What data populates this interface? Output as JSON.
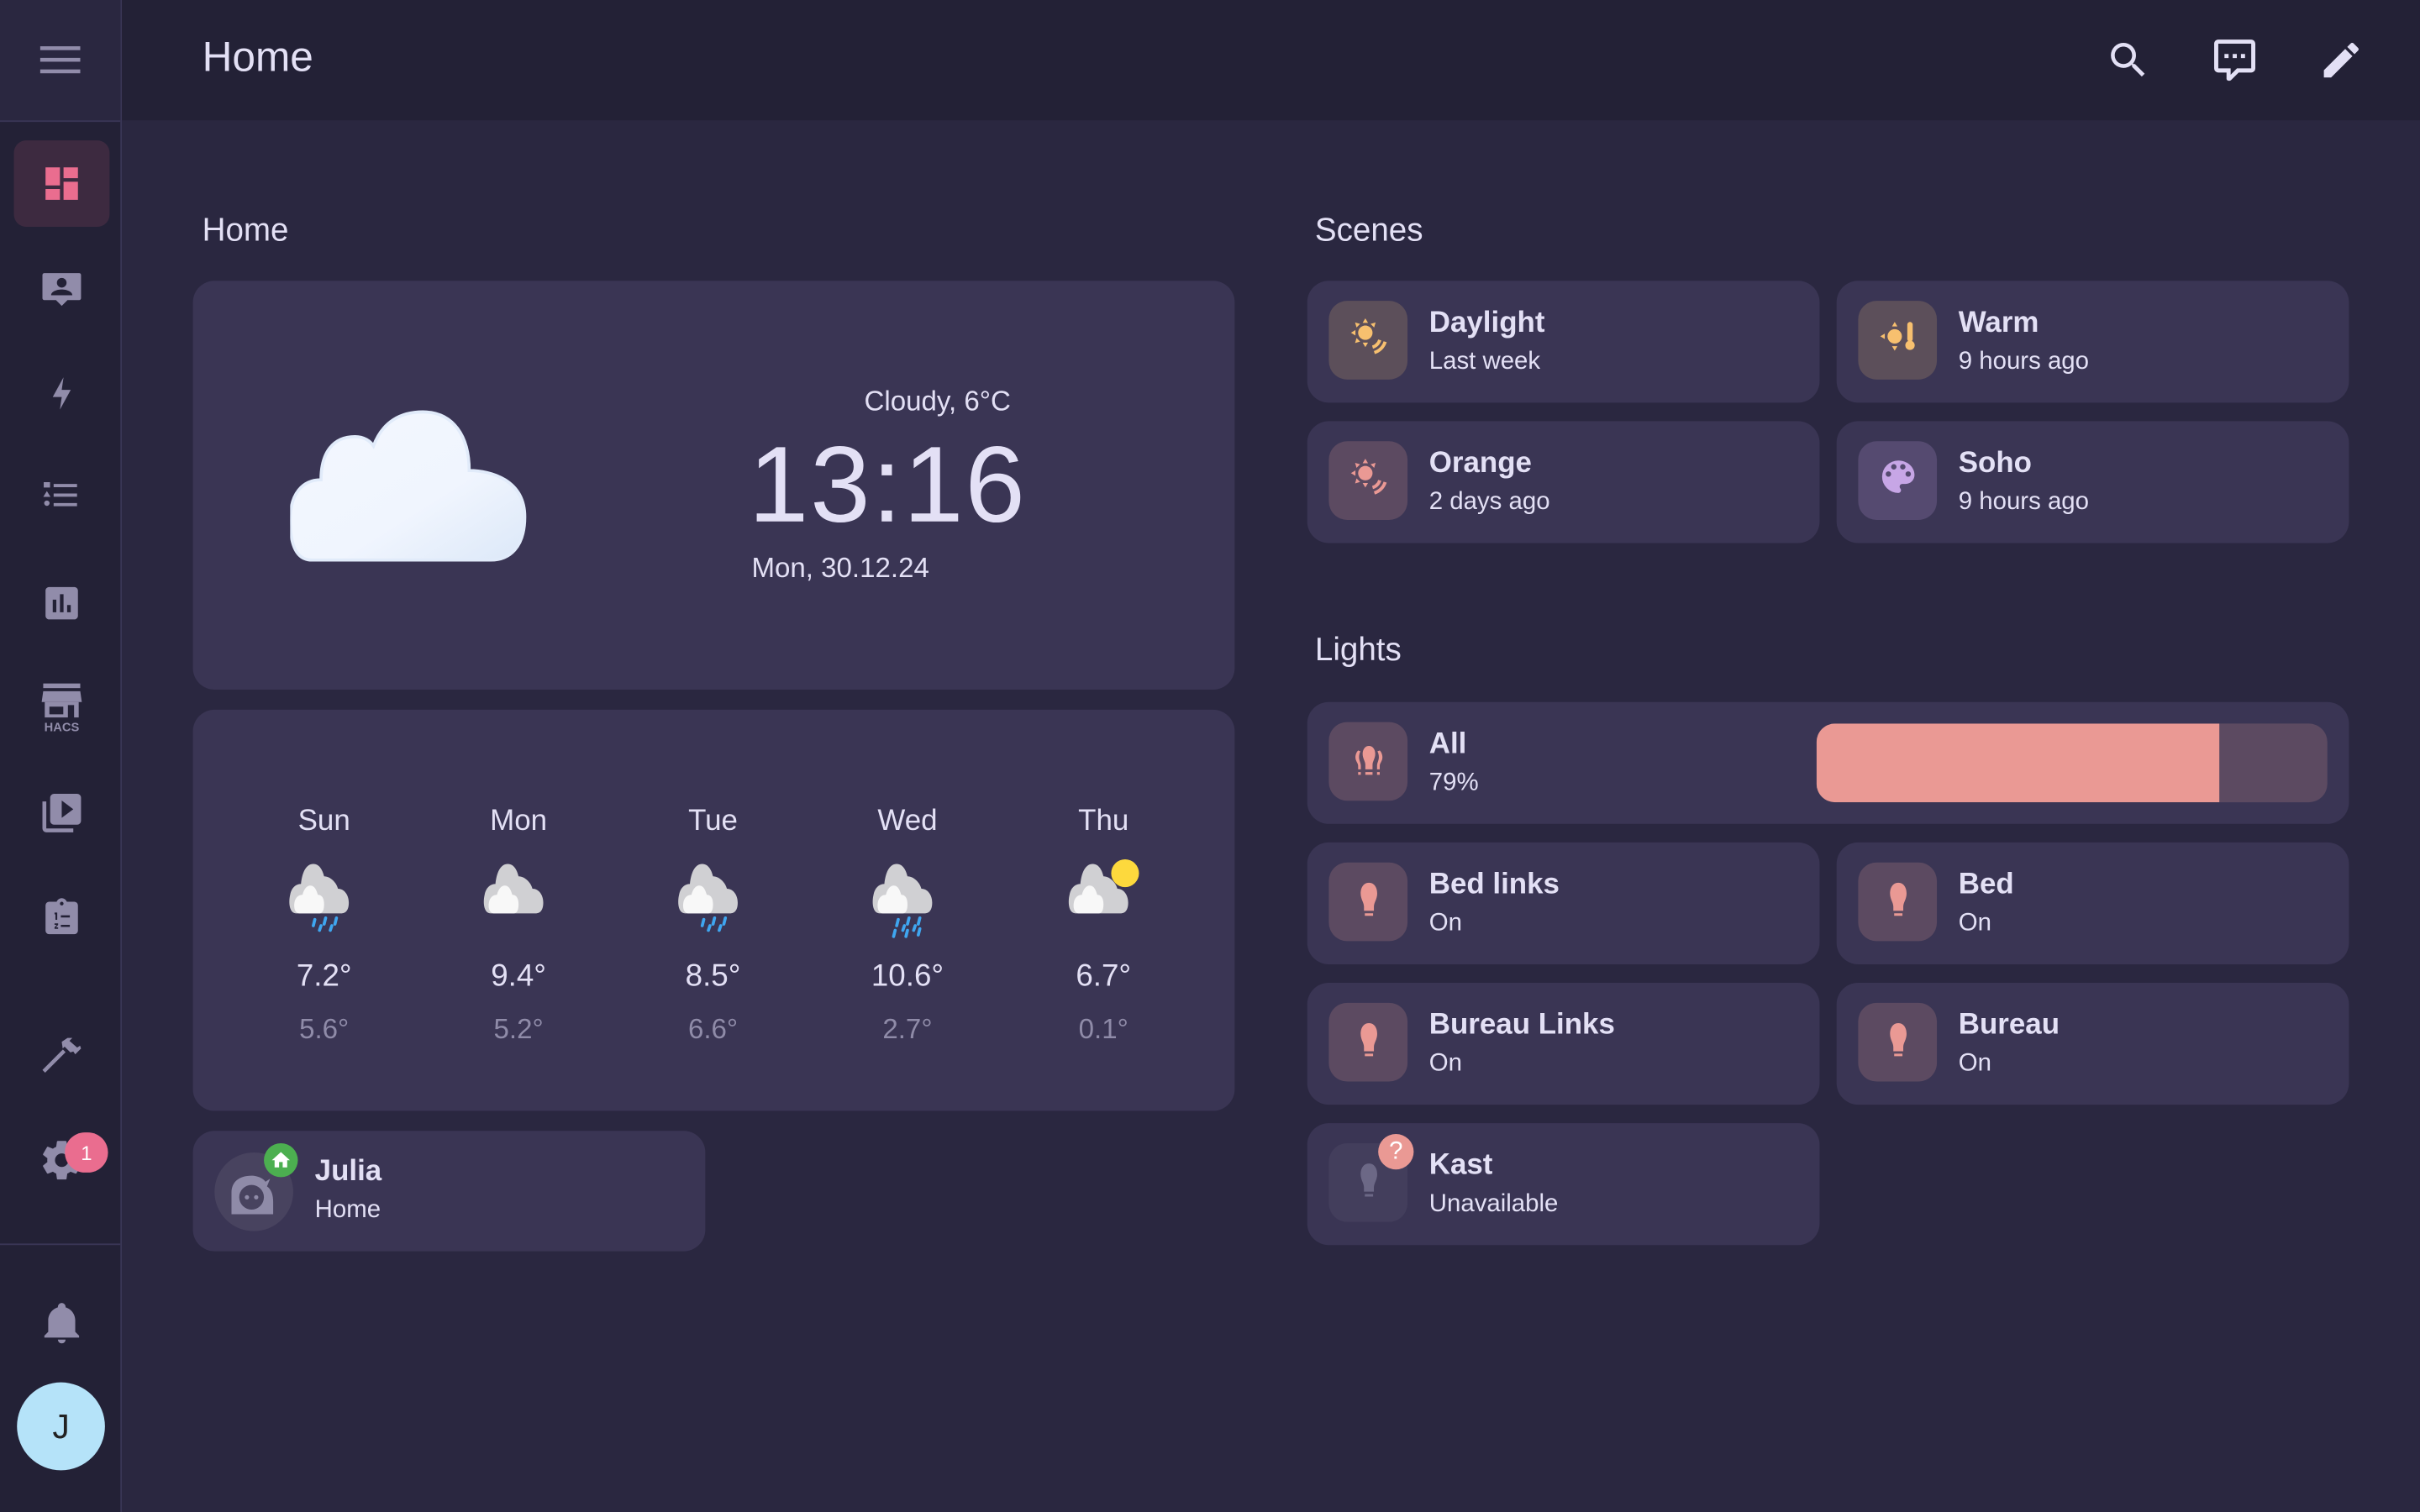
{
  "topbar": {
    "title": "Home",
    "icons": [
      "search-icon",
      "assist-chat-icon",
      "edit-pencil-icon"
    ]
  },
  "sidebar": {
    "items": [
      {
        "name": "overview",
        "icon": "dashboard-icon",
        "active": true
      },
      {
        "name": "map",
        "icon": "account-box-icon"
      },
      {
        "name": "energy",
        "icon": "lightning-icon"
      },
      {
        "name": "logbook",
        "icon": "format-list-icon"
      },
      {
        "name": "history",
        "icon": "chart-box-icon"
      },
      {
        "name": "hacs",
        "icon": "hacs-store-icon",
        "label": "HACS"
      },
      {
        "name": "media",
        "icon": "play-box-multiple-icon"
      },
      {
        "name": "todo",
        "icon": "clipboard-list-icon"
      },
      {
        "name": "developer-tools",
        "icon": "hammer-icon"
      },
      {
        "name": "settings",
        "icon": "cog-icon",
        "badge": "1"
      }
    ],
    "notifications_icon": "bell-icon",
    "user_initial": "J"
  },
  "home": {
    "section_title": "Home",
    "weather": {
      "condition": "Cloudy, 6°C",
      "time": "13:16",
      "date": "Mon, 30.12.24"
    },
    "forecast": [
      {
        "day": "Sun",
        "high": "7.2°",
        "low": "5.6°",
        "icon": "cloud-rain-icon"
      },
      {
        "day": "Mon",
        "high": "9.4°",
        "low": "5.2°",
        "icon": "cloud-icon"
      },
      {
        "day": "Tue",
        "high": "8.5°",
        "low": "6.6°",
        "icon": "cloud-rain-icon"
      },
      {
        "day": "Wed",
        "high": "10.6°",
        "low": "2.7°",
        "icon": "cloud-heavy-rain-icon"
      },
      {
        "day": "Thu",
        "high": "6.7°",
        "low": "0.1°",
        "icon": "cloud-sun-icon"
      }
    ],
    "person": {
      "name": "Julia",
      "state": "Home"
    }
  },
  "scenes": {
    "section_title": "Scenes",
    "items": [
      {
        "name": "Daylight",
        "state": "Last week",
        "icon": "sun-wireless-icon",
        "color": "#f7c06f"
      },
      {
        "name": "Warm",
        "state": "9 hours ago",
        "icon": "sun-thermometer-icon",
        "color": "#f7c06f"
      },
      {
        "name": "Orange",
        "state": "2 days ago",
        "icon": "sun-wireless-icon",
        "color": "#ea9994"
      },
      {
        "name": "Soho",
        "state": "9 hours ago",
        "icon": "palette-icon",
        "color": "#c7a6e6"
      }
    ]
  },
  "lights": {
    "section_title": "Lights",
    "all": {
      "name": "All",
      "state": "79%",
      "brightness_pct": 79
    },
    "items": [
      {
        "name": "Bed links",
        "state": "On"
      },
      {
        "name": "Bed",
        "state": "On"
      },
      {
        "name": "Bureau Links",
        "state": "On"
      },
      {
        "name": "Bureau",
        "state": "On"
      },
      {
        "name": "Kast",
        "state": "Unavailable",
        "unavailable": true
      }
    ]
  },
  "colors": {
    "accent": "#ea6d8f",
    "light_on": "#ea9994",
    "card_bg": "#3a3554",
    "page_bg": "#2a2740"
  }
}
